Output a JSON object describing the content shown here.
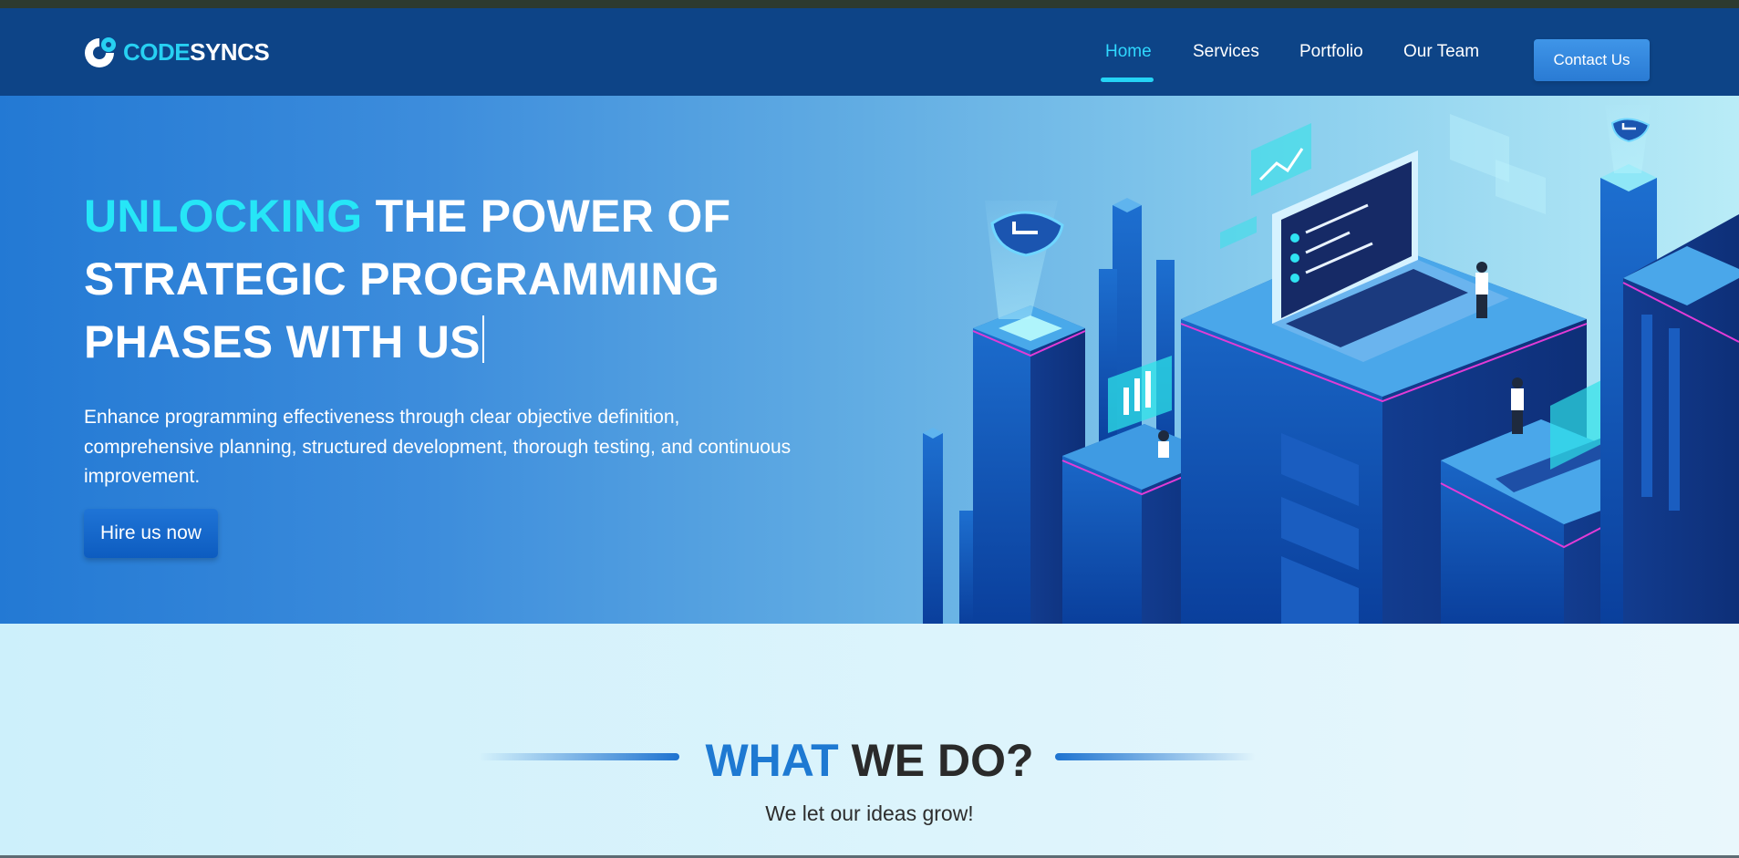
{
  "header": {
    "logo": {
      "part1": "CODE",
      "part2": "SYNCS"
    },
    "nav": [
      {
        "label": "Home",
        "active": true
      },
      {
        "label": "Services",
        "active": false
      },
      {
        "label": "Portfolio",
        "active": false
      },
      {
        "label": "Our Team",
        "active": false
      }
    ],
    "contact_label": "Contact Us"
  },
  "hero": {
    "title_highlight": "UNLOCKING",
    "title_line1_rest": " THE POWER OF",
    "title_line2": "STRATEGIC PROGRAMMING",
    "title_line3": "PHASES WITH US",
    "description_lines": [
      "Enhance programming effectiveness through clear objective definition,",
      "comprehensive planning, structured development, thorough testing, and continuous",
      "improvement."
    ],
    "cta_label": "Hire us now"
  },
  "section": {
    "title_highlight": "WHAT",
    "title_rest": " WE DO?",
    "subtitle": "We let our ideas grow!"
  },
  "colors": {
    "header_bg": "#0d4487",
    "accent_cyan": "#27d0f2",
    "hero_gradient_start": "#2379d4",
    "hero_gradient_end": "#b9ecf7",
    "section_accent": "#1e79d2"
  }
}
